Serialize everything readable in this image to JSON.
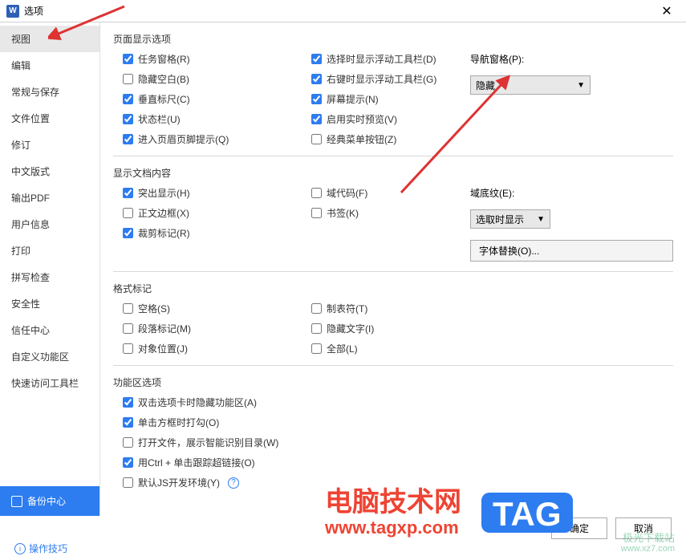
{
  "title": "选项",
  "app_icon": "W",
  "close_glyph": "✕",
  "sidebar": {
    "items": [
      {
        "label": "视图"
      },
      {
        "label": "编辑"
      },
      {
        "label": "常规与保存"
      },
      {
        "label": "文件位置"
      },
      {
        "label": "修订"
      },
      {
        "label": "中文版式"
      },
      {
        "label": "输出PDF"
      },
      {
        "label": "用户信息"
      },
      {
        "label": "打印"
      },
      {
        "label": "拼写检查"
      },
      {
        "label": "安全性"
      },
      {
        "label": "信任中心"
      },
      {
        "label": "自定义功能区"
      },
      {
        "label": "快速访问工具栏"
      }
    ],
    "backup_label": "备份中心"
  },
  "sections": {
    "page_display": {
      "title": "页面显示选项",
      "col1": [
        {
          "label": "任务窗格(R)",
          "checked": true
        },
        {
          "label": "隐藏空白(B)",
          "checked": false
        },
        {
          "label": "垂直标尺(C)",
          "checked": true
        },
        {
          "label": "状态栏(U)",
          "checked": true
        },
        {
          "label": "进入页眉页脚提示(Q)",
          "checked": true
        }
      ],
      "col2": [
        {
          "label": "选择时显示浮动工具栏(D)",
          "checked": true
        },
        {
          "label": "右键时显示浮动工具栏(G)",
          "checked": true
        },
        {
          "label": "屏幕提示(N)",
          "checked": true
        },
        {
          "label": "启用实时预览(V)",
          "checked": true
        },
        {
          "label": "经典菜单按钮(Z)",
          "checked": false
        }
      ],
      "nav_label": "导航窗格(P):",
      "nav_value": "隐藏"
    },
    "doc_content": {
      "title": "显示文档内容",
      "col1": [
        {
          "label": "突出显示(H)",
          "checked": true
        },
        {
          "label": "正文边框(X)",
          "checked": false
        },
        {
          "label": "裁剪标记(R)",
          "checked": true
        }
      ],
      "col2": [
        {
          "label": "域代码(F)",
          "checked": false
        },
        {
          "label": "书签(K)",
          "checked": false
        }
      ],
      "shade_label": "域底纹(E):",
      "shade_value": "选取时显示",
      "font_sub_btn": "字体替换(O)..."
    },
    "format_marks": {
      "title": "格式标记",
      "col1": [
        {
          "label": "空格(S)",
          "checked": false
        },
        {
          "label": "段落标记(M)",
          "checked": false
        },
        {
          "label": "对象位置(J)",
          "checked": false
        }
      ],
      "col2": [
        {
          "label": "制表符(T)",
          "checked": false
        },
        {
          "label": "隐藏文字(I)",
          "checked": false
        },
        {
          "label": "全部(L)",
          "checked": false
        }
      ]
    },
    "ribbon": {
      "title": "功能区选项",
      "items": [
        {
          "label": "双击选项卡时隐藏功能区(A)",
          "checked": true
        },
        {
          "label": "单击方框时打勾(O)",
          "checked": true
        },
        {
          "label": "打开文件，展示智能识别目录(W)",
          "checked": false
        },
        {
          "label": "用Ctrl + 单击跟踪超链接(O)",
          "checked": true
        },
        {
          "label": "默认JS开发环境(Y)",
          "checked": false,
          "help": true
        }
      ]
    }
  },
  "footer": {
    "ok": "确定",
    "cancel": "取消",
    "tip": "操作技巧"
  },
  "watermarks": {
    "w1_title": "电脑技术网",
    "w1_url": "www.tagxp.com",
    "tag": "TAG",
    "w2_title": "极光下载站",
    "w2_url": "www.xz7.com"
  }
}
